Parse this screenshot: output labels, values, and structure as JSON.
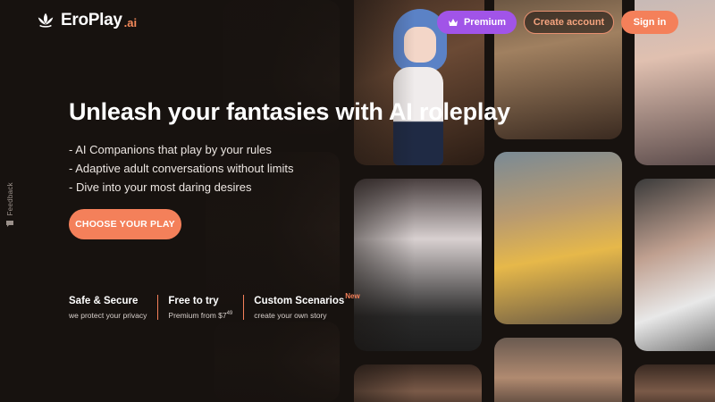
{
  "brand": {
    "name": "EroPlay",
    "suffix": ".ai"
  },
  "nav": {
    "premium_label": "Premium",
    "create_account_label": "Create account",
    "sign_in_label": "Sign in"
  },
  "hero": {
    "title": "Unleash your fantasies with AI roleplay",
    "bullets": [
      "- AI Companions that play by your rules",
      "- Adaptive adult conversations without limits",
      "- Dive into your most daring desires"
    ],
    "cta_label": "CHOOSE YOUR PLAY"
  },
  "features": [
    {
      "title": "Safe & Secure",
      "subtitle": "we protect your privacy"
    },
    {
      "title": "Free to try",
      "subtitle_prefix": "Premium from $7",
      "subtitle_sup": "49"
    },
    {
      "title": "Custom Scenarios",
      "badge": "New",
      "subtitle": "create your own story"
    }
  ],
  "feedback_label": "Feedback",
  "colors": {
    "accent": "#f4805a",
    "premium": "#a154e8",
    "background": "#17120f"
  },
  "icons": {
    "logo": "lotus-logo-icon",
    "premium": "crown-icon",
    "feedback": "chat-bubble-icon"
  }
}
